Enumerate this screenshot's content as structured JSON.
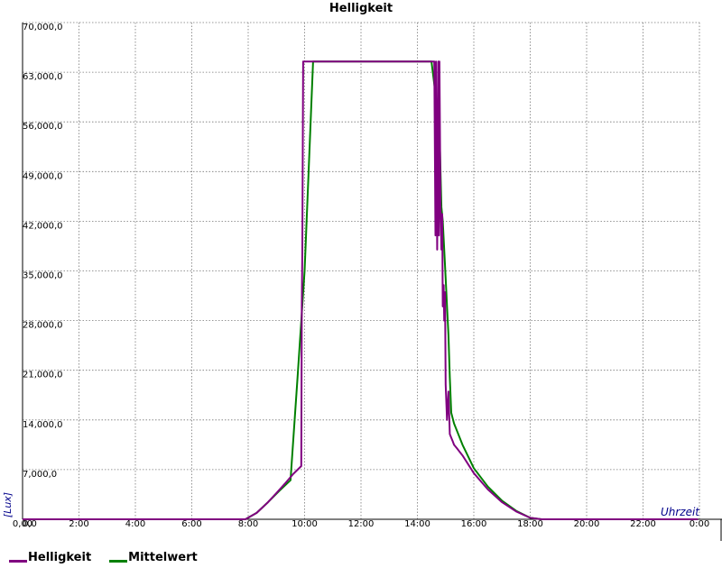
{
  "chart_data": {
    "type": "line",
    "title": "Helligkeit",
    "xlabel": "Uhrzeit",
    "ylabel": "[Lux]",
    "xlim": [
      0,
      24
    ],
    "ylim": [
      0,
      70000
    ],
    "x_ticks": [
      "0,00",
      "2:00",
      "4:00",
      "6:00",
      "8:00",
      "10:00",
      "12:00",
      "14:00",
      "16:00",
      "18:00",
      "20:00",
      "22:00",
      "0:00"
    ],
    "y_ticks": [
      "0,0",
      "7,000,0",
      "14,000,0",
      "21,000,0",
      "28,000,0",
      "35,000,0",
      "42,000,0",
      "49,000,0",
      "56,000,0",
      "63,000,0",
      "70,000,0"
    ],
    "grid": true,
    "legend_position": "bottom-left",
    "series": [
      {
        "name": "Helligkeit",
        "color": "#800080",
        "x": [
          0,
          7.9,
          8.3,
          8.7,
          9.0,
          9.3,
          9.6,
          9.88,
          9.9,
          9.92,
          9.95,
          10.5,
          11,
          12,
          13,
          14,
          14.6,
          14.64,
          14.66,
          14.7,
          14.72,
          14.74,
          14.76,
          14.78,
          14.82,
          14.85,
          14.88,
          14.9,
          14.93,
          14.95,
          14.98,
          15.0,
          15.05,
          15.1,
          15.15,
          15.2,
          15.25,
          15.3,
          15.4,
          15.6,
          16.0,
          16.5,
          17.0,
          17.5,
          18.0,
          18.4,
          20,
          22,
          23.95
        ],
        "y": [
          0,
          0,
          900,
          2400,
          3700,
          5000,
          6400,
          7500,
          30000,
          38000,
          64500,
          64500,
          64500,
          64500,
          64500,
          64500,
          64500,
          40000,
          64500,
          38000,
          50000,
          64500,
          40000,
          64500,
          44000,
          38000,
          43000,
          30000,
          33000,
          28000,
          32000,
          19000,
          14000,
          18000,
          12000,
          11500,
          11000,
          10500,
          10000,
          9000,
          6500,
          4200,
          2400,
          1100,
          200,
          0,
          0,
          0,
          0
        ]
      },
      {
        "name": "Mittelwert",
        "color": "#008000",
        "x": [
          0,
          7.9,
          8.3,
          8.7,
          9.1,
          9.5,
          9.75,
          10.0,
          10.3,
          10.5,
          11,
          12,
          13,
          14,
          14.5,
          14.7,
          14.75,
          14.8,
          14.85,
          14.9,
          14.95,
          15.0,
          15.05,
          15.1,
          15.15,
          15.2,
          15.3,
          15.6,
          16.0,
          16.5,
          17.0,
          17.5,
          18.0,
          18.4,
          20,
          22,
          23.95
        ],
        "y": [
          0,
          0,
          900,
          2400,
          4000,
          5500,
          20000,
          35000,
          64500,
          64500,
          64500,
          64500,
          64500,
          64500,
          64500,
          58000,
          48000,
          52000,
          44000,
          42000,
          38000,
          34000,
          30000,
          26000,
          20000,
          15000,
          13500,
          10500,
          7200,
          4600,
          2600,
          1200,
          200,
          0,
          0,
          0,
          0
        ]
      }
    ]
  }
}
